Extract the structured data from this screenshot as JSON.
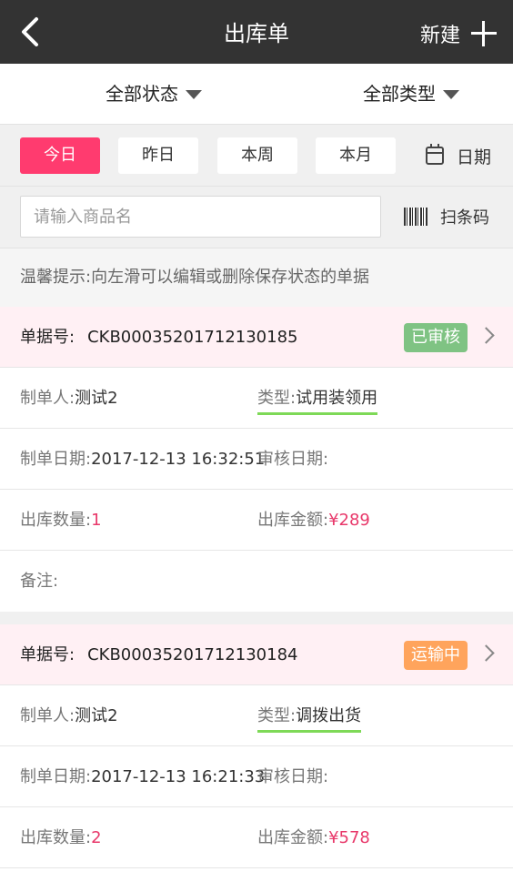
{
  "nav": {
    "title": "出库单",
    "new_label": "新建"
  },
  "filters": {
    "status": "全部状态",
    "type": "全部类型"
  },
  "dates": {
    "today": "今日",
    "yesterday": "昨日",
    "week": "本周",
    "month": "本月",
    "picker": "日期"
  },
  "search": {
    "placeholder": "请输入商品名",
    "scan_label": "扫条码"
  },
  "tip": "温馨提示:向左滑可以编辑或删除保存状态的单据",
  "labels": {
    "doc_no": "单据号:",
    "creator": "制单人:",
    "type": "类型:",
    "create_date": "制单日期:",
    "audit_date": "审核日期:",
    "qty": "出库数量:",
    "amount": "出库金额:",
    "note": "备注:"
  },
  "records": [
    {
      "doc_no": "CKB00035201712130185",
      "status": "已审核",
      "status_color": "#7fc383",
      "creator": "测试2",
      "type": "试用装领用",
      "create_date": "2017-12-13 16:32:51",
      "audit_date": "",
      "qty": "1",
      "amount": "¥289",
      "note": ""
    },
    {
      "doc_no": "CKB00035201712130184",
      "status": "运输中",
      "status_color": "#ffa45c",
      "creator": "测试2",
      "type": "调拨出货",
      "create_date": "2017-12-13 16:21:33",
      "audit_date": "",
      "qty": "2",
      "amount": "¥578"
    }
  ]
}
